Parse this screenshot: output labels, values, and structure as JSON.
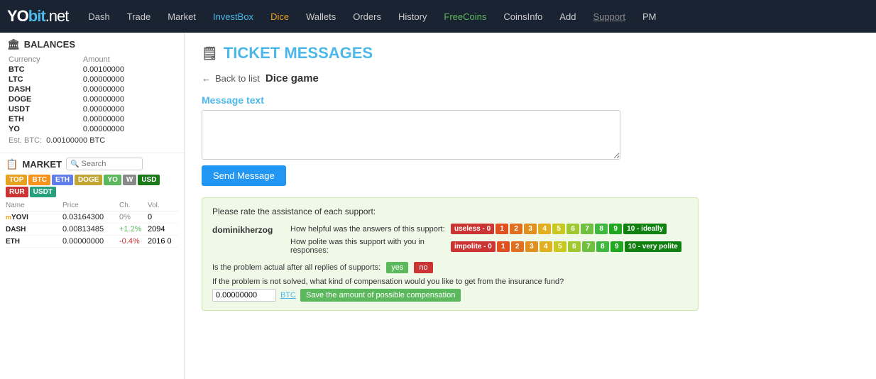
{
  "navbar": {
    "logo": {
      "yo": "YO",
      "bit": "bit",
      "net": ".net"
    },
    "items": [
      {
        "label": "Dash",
        "id": "dash"
      },
      {
        "label": "Trade",
        "id": "trade"
      },
      {
        "label": "Market",
        "id": "market"
      },
      {
        "label": "InvestBox",
        "id": "investbox",
        "class": "active-investbox"
      },
      {
        "label": "Dice",
        "id": "dice",
        "class": "active-dice"
      },
      {
        "label": "Wallets",
        "id": "wallets"
      },
      {
        "label": "Orders",
        "id": "orders"
      },
      {
        "label": "History",
        "id": "history"
      },
      {
        "label": "FreeCoins",
        "id": "freecoins",
        "class": "active-freecoins"
      },
      {
        "label": "CoinsInfo",
        "id": "coinsinfo"
      },
      {
        "label": "Add",
        "id": "add"
      },
      {
        "label": "Support",
        "id": "support",
        "class": "active-support"
      },
      {
        "label": "PM",
        "id": "pm"
      }
    ]
  },
  "sidebar": {
    "balances": {
      "title": "BALANCES",
      "col_currency": "Currency",
      "col_amount": "Amount",
      "rows": [
        {
          "currency": "BTC",
          "amount": "0.00100000"
        },
        {
          "currency": "LTC",
          "amount": "0.00000000"
        },
        {
          "currency": "DASH",
          "amount": "0.00000000"
        },
        {
          "currency": "DOGE",
          "amount": "0.00000000"
        },
        {
          "currency": "USDT",
          "amount": "0.00000000"
        },
        {
          "currency": "ETH",
          "amount": "0.00000000"
        },
        {
          "currency": "YO",
          "amount": "0.00000000"
        }
      ],
      "est_btc_label": "Est. BTC:",
      "est_btc_value": "0.00100000 BTC"
    },
    "market": {
      "title": "MARKET",
      "search_placeholder": "Search",
      "tabs": [
        "TOP",
        "BTC",
        "ETH",
        "DOGE",
        "YO",
        "W",
        "USD",
        "RUR",
        "USDT"
      ],
      "col_name": "Name",
      "col_price": "Price",
      "col_ch": "Ch.",
      "col_vol": "Vol.",
      "rows": [
        {
          "prefix": "m",
          "name": "YOVI",
          "price": "0.03164300",
          "ch": "0%",
          "vol": "0"
        },
        {
          "prefix": "",
          "name": "DASH",
          "price": "0.00813485",
          "ch": "+1.2%",
          "vol": "2094"
        },
        {
          "prefix": "",
          "name": "ETH",
          "price": "0.00000000",
          "ch": "-0.4%",
          "vol": "2016 0"
        }
      ]
    }
  },
  "main": {
    "page_title": "TICKET MESSAGES",
    "back_label": "← Back to list",
    "ticket_title": "Dice game",
    "message_label": "Message text",
    "message_placeholder": "",
    "send_btn": "Send Message",
    "rating": {
      "intro": "Please rate the assistance of each support:",
      "user": "dominikherzog",
      "q1": "How helpful was the answers of this support:",
      "q2": "How polite was this support with you in responses:",
      "btns_helpfulness": [
        "useless - 0",
        "1",
        "2",
        "3",
        "4",
        "5",
        "6",
        "7",
        "8",
        "9",
        "10 - ideally"
      ],
      "btns_polite": [
        "impolite - 0",
        "1",
        "2",
        "3",
        "4",
        "5",
        "6",
        "7",
        "8",
        "9",
        "10 - very polite"
      ],
      "problem_q": "Is the problem actual after all replies of supports:",
      "yes_label": "yes",
      "no_label": "no",
      "compensation_q": "If the problem is not solved, what kind of compensation would you like to get from the insurance fund?",
      "comp_amount": "0.00000000",
      "comp_currency": "BTC",
      "comp_save": "Save the amount of possible compensation"
    }
  }
}
